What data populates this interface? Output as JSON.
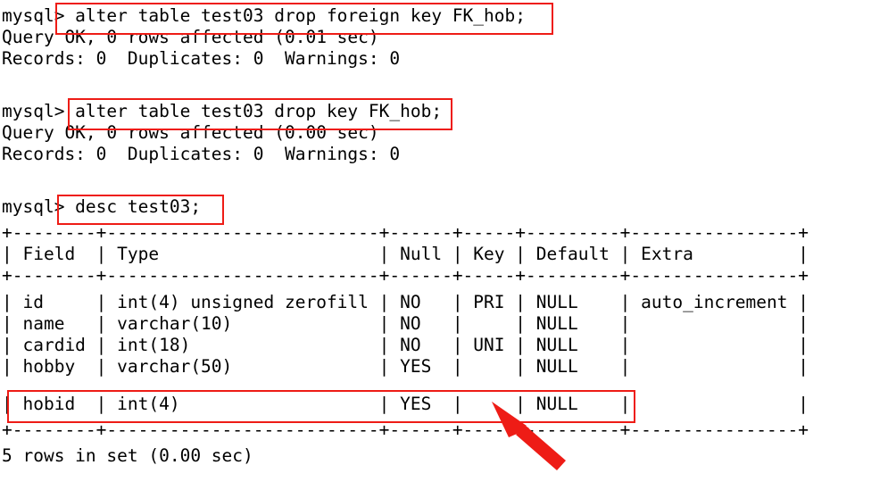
{
  "terminal": {
    "prompt": "mysql>",
    "lines": [
      {
        "id": "cmd1",
        "text": "mysql> alter table test03 drop foreign key FK_hob;"
      },
      {
        "id": "cmd1-result",
        "text": "Query OK, 0 rows affected (0.01 sec)"
      },
      {
        "id": "cmd1-stats",
        "text": "Records: 0  Duplicates: 0  Warnings: 0"
      },
      {
        "id": "blank1",
        "text": " "
      },
      {
        "id": "cmd2",
        "text": "mysql> alter table test03 drop key FK_hob;"
      },
      {
        "id": "cmd2-result",
        "text": "Query OK, 0 rows affected (0.00 sec)"
      },
      {
        "id": "cmd2-stats",
        "text": "Records: 0  Duplicates: 0  Warnings: 0"
      },
      {
        "id": "blank2",
        "text": " "
      },
      {
        "id": "cmd3",
        "text": "mysql> desc test03;"
      },
      {
        "id": "rule-top",
        "text": "+--------+--------------------------+------+-----+---------+----------------+"
      },
      {
        "id": "hdr",
        "text": "| Field  | Type                     | Null | Key | Default | Extra          |"
      },
      {
        "id": "rule-mid",
        "text": "+--------+--------------------------+------+-----+---------+----------------+"
      },
      {
        "id": "row-id",
        "text": "| id     | int(4) unsigned zerofill | NO   | PRI | NULL    | auto_increment |"
      },
      {
        "id": "row-name",
        "text": "| name   | varchar(10)              | NO   |     | NULL    |                |"
      },
      {
        "id": "row-cardid",
        "text": "| cardid | int(18)                  | NO   | UNI | NULL    |                |"
      },
      {
        "id": "row-hobby",
        "text": "| hobby  | varchar(50)              | YES  |     | NULL    |                |"
      },
      {
        "id": "row-hobid",
        "text": "| hobid  | int(4)                   | YES  |     | NULL    |                |"
      },
      {
        "id": "rule-bot",
        "text": "+--------+--------------------------+------+-----+---------+----------------+"
      },
      {
        "id": "rowcount",
        "text": "5 rows in set (0.00 sec)"
      }
    ],
    "commands": [
      "alter table test03 drop foreign key FK_hob;",
      "alter table test03 drop key FK_hob;",
      "desc test03;"
    ],
    "table": {
      "columns": [
        "Field",
        "Type",
        "Null",
        "Key",
        "Default",
        "Extra"
      ],
      "rows": [
        [
          "id",
          "int(4) unsigned zerofill",
          "NO",
          "PRI",
          "NULL",
          "auto_increment"
        ],
        [
          "name",
          "varchar(10)",
          "NO",
          "",
          "NULL",
          ""
        ],
        [
          "cardid",
          "int(18)",
          "NO",
          "UNI",
          "NULL",
          ""
        ],
        [
          "hobby",
          "varchar(50)",
          "YES",
          "",
          "NULL",
          ""
        ],
        [
          "hobid",
          "int(4)",
          "YES",
          "",
          "NULL",
          ""
        ]
      ],
      "footer": "5 rows in set (0.00 sec)"
    }
  },
  "annotations": {
    "color": "#ee1c16",
    "boxes": [
      {
        "id": "highlight-command-1",
        "label": "alter table test03 drop foreign key FK_hob;"
      },
      {
        "id": "highlight-command-2",
        "label": "alter table test03 drop key FK_hob;"
      },
      {
        "id": "highlight-command-3",
        "label": "desc test03;"
      },
      {
        "id": "highlight-row-hobid",
        "label": "| hobid  | int(4)                   | YES  |     | NULL    |                |"
      }
    ],
    "arrow": {
      "id": "pointer-arrow",
      "points_to": "Key column of hobid row is now empty"
    }
  }
}
